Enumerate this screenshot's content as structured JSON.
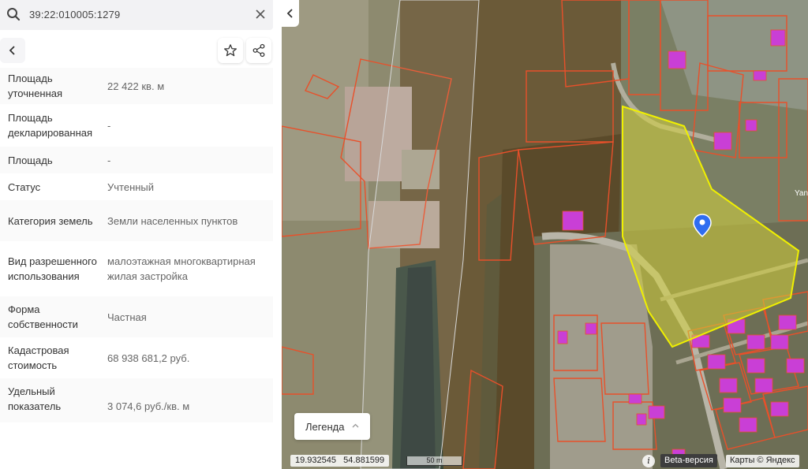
{
  "search": {
    "query": "39:22:010005:1279",
    "icon": "search-icon",
    "clear_icon": "close-icon"
  },
  "actions": {
    "back_icon": "chevron-left-icon",
    "favorite_icon": "star-icon",
    "share_icon": "share-icon"
  },
  "properties": [
    {
      "key": "Площадь уточненная",
      "value": "22 422 кв. м"
    },
    {
      "key": "Площадь декларированная",
      "value": "-"
    },
    {
      "key": "Площадь",
      "value": "-"
    },
    {
      "key": "Статус",
      "value": "Учтенный"
    },
    {
      "key": "Категория земель",
      "value": "Земли населенных пунктов"
    },
    {
      "key": "Вид разрешенного использования",
      "value": "малоэтажная многоквартирная жилая застройка"
    },
    {
      "key": "Форма собственности",
      "value": "Частная"
    },
    {
      "key": "Кадастровая стоимость",
      "value": "68 938 681,2 руб."
    },
    {
      "key": "Удельный показатель",
      "value": "3 074,6 руб./кв. м"
    }
  ],
  "map": {
    "legend_label": "Легенда",
    "coordinates": "19.932545   54.881599",
    "scale_label": "50 m",
    "info_label": "i",
    "beta_label": "Beta-версия",
    "attribution": "Карты © Яндекс",
    "street_fragment": "Yan",
    "colors": {
      "parcel_outline": "#e8502a",
      "selected_fill": "#d4d23a",
      "selected_outline": "#f0f000",
      "building": "#c93fd6",
      "marker": "#2f6df0"
    }
  }
}
